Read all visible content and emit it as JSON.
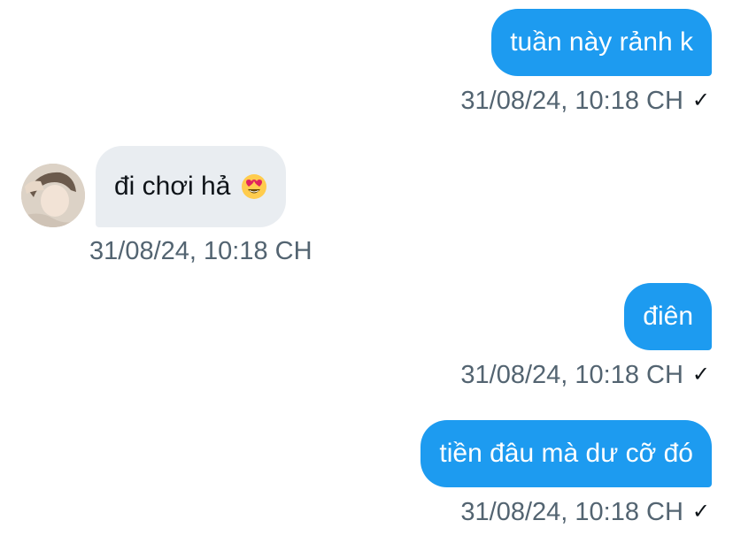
{
  "conversation": {
    "messages": [
      {
        "direction": "outgoing",
        "text": "tuần này rảnh k",
        "timestamp": "31/08/24, 10:18 CH",
        "status_icon": "checkmark-icon",
        "status_glyph": "✓"
      },
      {
        "direction": "incoming",
        "text": "đi chơi hả",
        "emoji_icon": "heart-eyes-emoji-icon",
        "timestamp": "31/08/24, 10:18 CH"
      },
      {
        "direction": "outgoing",
        "text": "điên",
        "timestamp": "31/08/24, 10:18 CH",
        "status_icon": "checkmark-icon",
        "status_glyph": "✓"
      },
      {
        "direction": "outgoing",
        "text": "tiền đâu mà dư cỡ đó",
        "timestamp": "31/08/24, 10:18 CH",
        "status_icon": "checkmark-icon",
        "status_glyph": "✓"
      }
    ]
  },
  "colors": {
    "outgoing_bubble": "#1d9bf0",
    "incoming_bubble": "#e9edf1",
    "timestamp_text": "#536471"
  }
}
